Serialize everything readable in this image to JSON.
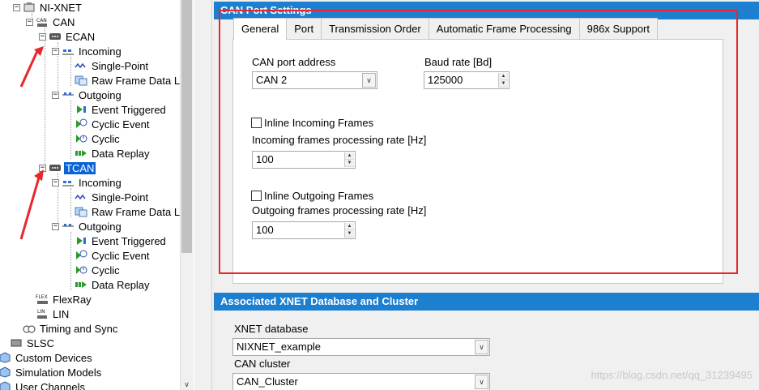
{
  "tree": {
    "items": [
      {
        "label": "NI-XNET",
        "icon": "xnet-icon"
      },
      {
        "label": "CAN",
        "icon": "can-icon"
      },
      {
        "label": "ECAN",
        "icon": "port-icon"
      },
      {
        "label": "Incoming",
        "icon": "incoming-icon"
      },
      {
        "label": "Single-Point",
        "icon": "single-point-icon"
      },
      {
        "label": "Raw Frame Data Lo",
        "icon": "raw-frame-icon"
      },
      {
        "label": "Outgoing",
        "icon": "outgoing-icon"
      },
      {
        "label": "Event Triggered",
        "icon": "event-triggered-icon"
      },
      {
        "label": "Cyclic Event",
        "icon": "cyclic-event-icon"
      },
      {
        "label": "Cyclic",
        "icon": "cyclic-icon"
      },
      {
        "label": "Data Replay",
        "icon": "data-replay-icon"
      },
      {
        "label": "TCAN",
        "icon": "port-icon"
      },
      {
        "label": "Incoming",
        "icon": "incoming-icon"
      },
      {
        "label": "Single-Point",
        "icon": "single-point-icon"
      },
      {
        "label": "Raw Frame Data Lo",
        "icon": "raw-frame-icon"
      },
      {
        "label": "Outgoing",
        "icon": "outgoing-icon"
      },
      {
        "label": "Event Triggered",
        "icon": "event-triggered-icon"
      },
      {
        "label": "Cyclic Event",
        "icon": "cyclic-event-icon"
      },
      {
        "label": "Cyclic",
        "icon": "cyclic-icon"
      },
      {
        "label": "Data Replay",
        "icon": "data-replay-icon"
      },
      {
        "label": "FlexRay",
        "icon": "flexray-icon"
      },
      {
        "label": "LIN",
        "icon": "lin-icon"
      },
      {
        "label": "Timing and Sync",
        "icon": "timing-icon"
      },
      {
        "label": "SLSC",
        "icon": "slsc-icon"
      },
      {
        "label": "Custom Devices",
        "icon": "cube-icon"
      },
      {
        "label": "Simulation Models",
        "icon": "cube-icon"
      },
      {
        "label": "User Channels",
        "icon": "cube-icon"
      }
    ],
    "icon_glyphs": {
      "can": "CAN",
      "flexray": "FLEX",
      "lin": "LIN"
    }
  },
  "port_settings": {
    "header": "CAN Port Settings",
    "tabs": [
      "General",
      "Port",
      "Transmission Order",
      "Automatic Frame Processing",
      "986x Support"
    ],
    "active_tab": "General",
    "can_port_address_label": "CAN port address",
    "can_port_address_value": "CAN 2",
    "baud_rate_label": "Baud rate [Bd]",
    "baud_rate_value": "125000",
    "inline_incoming_label": "Inline Incoming Frames",
    "incoming_rate_label": "Incoming frames processing rate [Hz]",
    "incoming_rate_value": "100",
    "inline_outgoing_label": "Inline Outgoing Frames",
    "outgoing_rate_label": "Outgoing frames processing rate [Hz]",
    "outgoing_rate_value": "100"
  },
  "database": {
    "header": "Associated XNET Database and Cluster",
    "xnet_database_label": "XNET database",
    "xnet_database_value": "NIXNET_example",
    "can_cluster_label": "CAN cluster",
    "can_cluster_value": "CAN_Cluster"
  },
  "glyphs": {
    "expand": "−",
    "dropdown": "∨",
    "up": "▲",
    "down": "▼"
  },
  "watermark": "https://blog.csdn.net/qq_31239495",
  "colors": {
    "accent": "#1c7fd0",
    "selection": "#0a64d8",
    "annotation": "#e8262b"
  }
}
